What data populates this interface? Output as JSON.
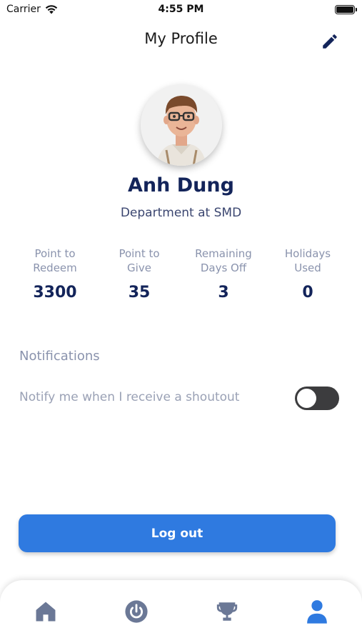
{
  "status_bar": {
    "carrier": "Carrier",
    "time": "4:55 PM"
  },
  "header": {
    "title": "My Profile",
    "edit_icon": "pencil-icon"
  },
  "profile": {
    "name": "Anh Dung",
    "department": "Department at SMD"
  },
  "stats": [
    {
      "label": "Point to\nRedeem",
      "value": "3300"
    },
    {
      "label": "Point to\nGive",
      "value": "35"
    },
    {
      "label": "Remaining\nDays Off",
      "value": "3"
    },
    {
      "label": "Holidays\nUsed",
      "value": "0"
    }
  ],
  "notifications": {
    "title": "Notifications",
    "shoutout_label": "Notify me when I receive a shoutout",
    "shoutout_enabled": false
  },
  "logout_label": "Log out",
  "tabs": [
    {
      "icon": "home-icon",
      "active": false
    },
    {
      "icon": "power-icon",
      "active": false
    },
    {
      "icon": "trophy-icon",
      "active": false
    },
    {
      "icon": "profile-icon",
      "active": true
    }
  ],
  "colors": {
    "primary": "#2f7ae0",
    "heading": "#13245a",
    "muted": "#8a93ad",
    "tab_inactive": "#6b7896"
  }
}
